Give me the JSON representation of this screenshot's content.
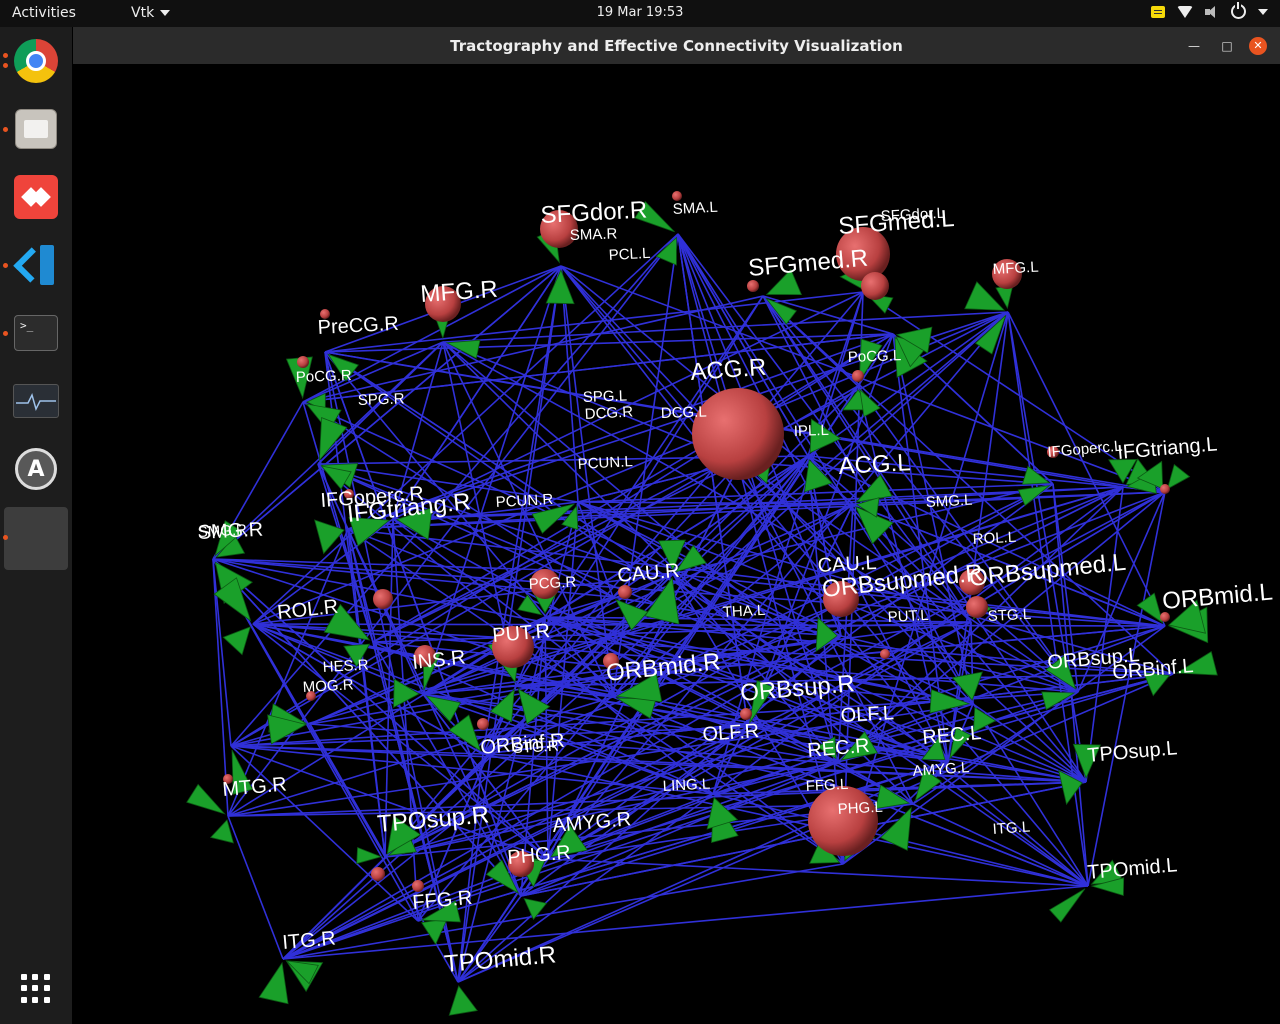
{
  "topbar": {
    "activities": "Activities",
    "app_menu": "Vtk",
    "clock": "19 Mar  19:53"
  },
  "dock": {
    "items": [
      "chrome-icon",
      "files-icon",
      "anydesk-icon",
      "vscode-icon",
      "terminal-icon",
      "system-monitor-icon",
      "software-updater-icon",
      "vtk-window-icon",
      "show-applications-icon"
    ]
  },
  "window": {
    "title": "Tractography and Effective Connectivity Visualization"
  },
  "colors": {
    "edge": "#3030d8",
    "node": "#c84a4a",
    "arrow": "#1aa02a",
    "background": "#000000"
  },
  "scene": {
    "labels": [
      {
        "text": "SFGdor.R",
        "size": "large"
      },
      {
        "text": "SMA.L",
        "size": "small"
      },
      {
        "text": "SMA.R",
        "size": "small"
      },
      {
        "text": "PCL.L",
        "size": "small"
      },
      {
        "text": "SFGdor.L",
        "size": "small"
      },
      {
        "text": "SFGmed.L",
        "size": "large"
      },
      {
        "text": "SFGmed.R",
        "size": "large"
      },
      {
        "text": "MFG.L",
        "size": "small"
      },
      {
        "text": "MFG.R",
        "size": "large"
      },
      {
        "text": "PreCG.R",
        "size": "medium"
      },
      {
        "text": "PoCG.L",
        "size": "small"
      },
      {
        "text": "PoCG.R",
        "size": "small"
      },
      {
        "text": "SPG.R",
        "size": "small"
      },
      {
        "text": "SPG.L",
        "size": "small"
      },
      {
        "text": "ACG.R",
        "size": "large"
      },
      {
        "text": "DCG.R",
        "size": "small"
      },
      {
        "text": "DCG.L",
        "size": "small"
      },
      {
        "text": "IPL.L",
        "size": "small"
      },
      {
        "text": "ACG.L",
        "size": "large"
      },
      {
        "text": "IFGoperc.L",
        "size": "small"
      },
      {
        "text": "IFGtriang.L",
        "size": "medium"
      },
      {
        "text": "IFGoperc.R",
        "size": "medium"
      },
      {
        "text": "IFGtriang.R",
        "size": "large"
      },
      {
        "text": "PCUN.L",
        "size": "small"
      },
      {
        "text": "PCUN.R",
        "size": "small"
      },
      {
        "text": "SMG.L",
        "size": "small"
      },
      {
        "text": "SMG.R",
        "size": "small"
      },
      {
        "text": "ROL.L",
        "size": "small"
      },
      {
        "text": "ROL.R",
        "size": "medium"
      },
      {
        "text": "CAU.L",
        "size": "medium"
      },
      {
        "text": "CAU.R",
        "size": "medium"
      },
      {
        "text": "PCG.R",
        "size": "small"
      },
      {
        "text": "ORBsupmed.R",
        "size": "large"
      },
      {
        "text": "ORBsupmed.L",
        "size": "large"
      },
      {
        "text": "ORBmid.L",
        "size": "large"
      },
      {
        "text": "STG.L",
        "size": "small"
      },
      {
        "text": "THA.L",
        "size": "small"
      },
      {
        "text": "PUT.L",
        "size": "small"
      },
      {
        "text": "PUT.R",
        "size": "medium"
      },
      {
        "text": "INS.R",
        "size": "medium"
      },
      {
        "text": "HES.R",
        "size": "small"
      },
      {
        "text": "ORBmid.R",
        "size": "large"
      },
      {
        "text": "ORBsup.L",
        "size": "medium"
      },
      {
        "text": "ORBinf.L",
        "size": "medium"
      },
      {
        "text": "ORBsup.R",
        "size": "large"
      },
      {
        "text": "MOG.R",
        "size": "small"
      },
      {
        "text": "OLF.L",
        "size": "medium"
      },
      {
        "text": "OLF.R",
        "size": "medium"
      },
      {
        "text": "ORBinf.R",
        "size": "medium"
      },
      {
        "text": "REC.L",
        "size": "medium"
      },
      {
        "text": "REC.R",
        "size": "medium"
      },
      {
        "text": "ITG.L",
        "size": "small"
      },
      {
        "text": "AMYG.L",
        "size": "small"
      },
      {
        "text": "TPOsup.L",
        "size": "medium"
      },
      {
        "text": "LING.L",
        "size": "small"
      },
      {
        "text": "FFG.L",
        "size": "small"
      },
      {
        "text": "PHG.L",
        "size": "small"
      },
      {
        "text": "MTG.R",
        "size": "medium"
      },
      {
        "text": "TPOsup.R",
        "size": "large"
      },
      {
        "text": "AMYG.R",
        "size": "medium"
      },
      {
        "text": "PHG.R",
        "size": "medium"
      },
      {
        "text": "TPOmid.L",
        "size": "medium"
      },
      {
        "text": "FFG.R",
        "size": "medium"
      },
      {
        "text": "ITG.R",
        "size": "medium"
      },
      {
        "text": "TPOmid.R",
        "size": "large"
      },
      {
        "text": "SMG.R",
        "size": "medium"
      },
      {
        "text": "STG.R",
        "size": "small"
      }
    ]
  }
}
